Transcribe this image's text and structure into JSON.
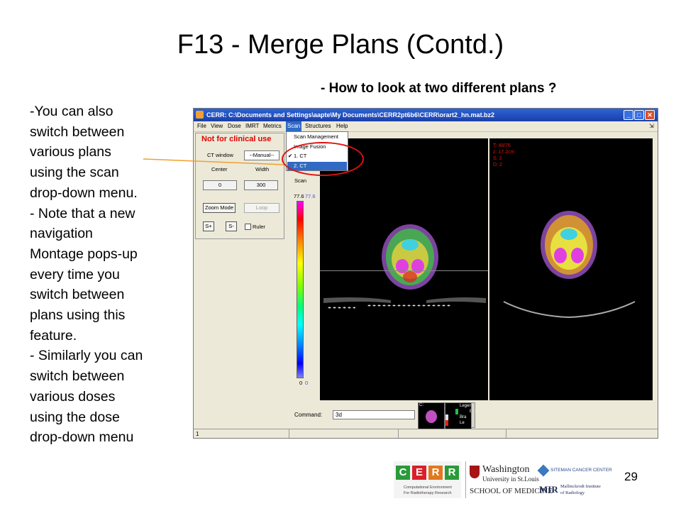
{
  "slide": {
    "title": "F13 - Merge Plans (Contd.)",
    "subtitle": "- How to look at two different plans ?",
    "bullet_lines": [
      "-You can also",
      "switch between",
      "various plans",
      "using the scan",
      "drop-down menu.",
      "- Note that a new",
      "navigation",
      "Montage pops-up",
      "every time you",
      "switch between",
      "plans using this",
      "feature.",
      "- Similarly you can",
      "switch between",
      "various doses",
      "using the dose",
      "drop-down menu"
    ],
    "page_number": "29"
  },
  "window": {
    "title": "CERR:  C:\\Documents and Settings\\aapte\\My Documents\\CERR2pt6b6\\CERR\\orart2_hn.mat.bz2",
    "controls": {
      "minimize": "_",
      "maximize": "□",
      "close": "✕"
    },
    "menus": [
      "File",
      "View",
      "Dose",
      "IMRT",
      "Metrics",
      "Scan",
      "Structures",
      "Help"
    ],
    "selected_menu": "Scan",
    "scan_menu_items": [
      "Scan Management",
      "Image Fusion",
      "1.  CT",
      "2.  CT"
    ],
    "checked_item_mark": "✔",
    "panel": {
      "warning": "Not for clinical use",
      "ct_window_label": "CT window",
      "ct_window_value": "--Manual--",
      "center_label": "Center",
      "width_label": "Width",
      "center_value": "0",
      "width_value": "300",
      "zoom_mode": "Zoom Mode",
      "loop": "Loop",
      "s_plus": "S+",
      "s_minus": "S-",
      "ruler": "Ruler",
      "scan_label": "Scan",
      "colorbar_top_left": "77.6",
      "colorbar_top_right": "77.6",
      "colorbar_bottom_left": "0",
      "colorbar_bottom_right": "0"
    },
    "viewer_info": [
      "T: 48/76",
      "z: 17.2cm",
      "S: 2",
      "D: 2"
    ],
    "legend_items": [
      "Legen",
      "Bra",
      "Bra",
      "Le"
    ],
    "command_label": "Command:",
    "command_value": "3d",
    "status_value": "1"
  },
  "logos": {
    "cerr_letters": [
      "C",
      "E",
      "R",
      "R"
    ],
    "cerr_colors": [
      "#2a9a3a",
      "#d8202a",
      "#e07820",
      "#2a9a3a"
    ],
    "cerr_caption_1": "Computational Environment",
    "cerr_caption_2": "For Radiotherapy Research",
    "wu_line1": "Washington",
    "wu_line2": "University in St.Louis",
    "wu_line3": "SCHOOL OF MEDICINE",
    "siteman": "SITEMAN CANCER CENTER",
    "mir_abbr": "MIR",
    "mir_line1": "Mallinckrodt Institute",
    "mir_line2": "of Radiology"
  }
}
